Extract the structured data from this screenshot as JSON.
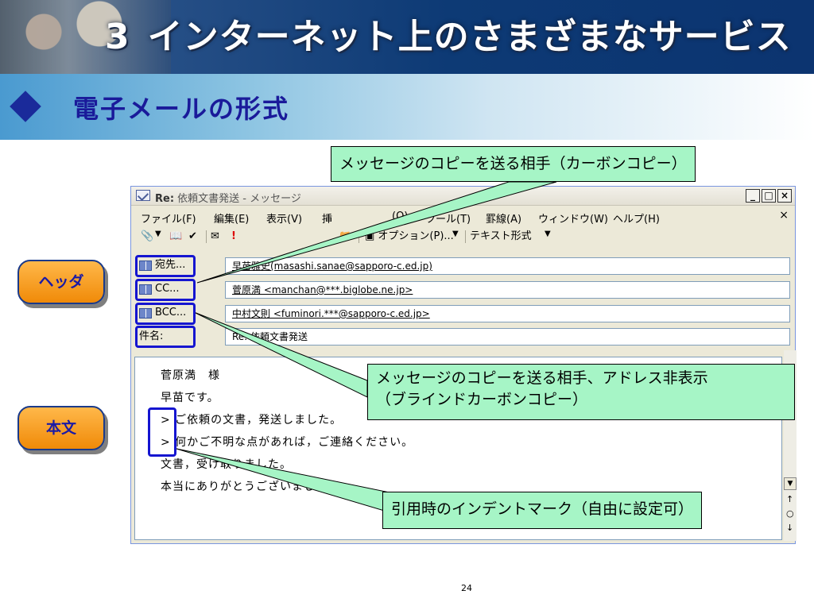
{
  "slide": {
    "title_number": "3",
    "title_text": "インターネット上のさまざまなサービス",
    "subtitle": "電子メールの形式",
    "page_number": "24"
  },
  "window": {
    "title_bold": "Re:",
    "title_rest": "依頼文書発送 - メッセージ",
    "buttons": [
      "_",
      "□",
      "×"
    ],
    "menu": [
      "ファイル(F)",
      "編集(E)",
      "表示(V)",
      "挿",
      "(O)",
      "ツール(T)",
      "罫線(A)",
      "ウィンドウ(W)",
      "ヘルプ(H)"
    ],
    "menu_close": "×",
    "toolbar": {
      "options_label": "オプション(P)...",
      "format_label": "テキスト形式"
    },
    "headers": {
      "to": {
        "label": "宛先...",
        "value": "早苗雅史(masashi.sanae@sapporo-c.ed.jp)"
      },
      "cc": {
        "label": "CC...",
        "value": "菅原満 <manchan@***.biglobe.ne.jp>"
      },
      "bcc": {
        "label": "BCC...",
        "value": "中村文則 <fuminori.***@sapporo-c.ed.jp>"
      },
      "subject": {
        "label": "件名:",
        "value": "Re: 依頼文書発送"
      }
    },
    "body_lines": [
      "菅原満　様",
      "早苗です。",
      "> ご依頼の文書，発送しました。",
      "> 何かご不明な点があれば，ご連絡ください。",
      "文書，受け取りました。",
      "本当にありがとうございました。"
    ]
  },
  "callouts": {
    "cc": "メッセージのコピーを送る相手（カーボンコピー）",
    "bcc_line1": "メッセージのコピーを送る相手、アドレス非表示",
    "bcc_line2": "（ブラインドカーボンコピー）",
    "quote": "引用時のインデントマーク（自由に設定可）"
  },
  "side_labels": {
    "header": "ヘッダ",
    "body": "本文"
  },
  "colors": {
    "callout_bg": "#a6f5c6",
    "highlight": "#1515d0",
    "pill_bg": "#f5a022",
    "title_text": "#1a1a9a"
  }
}
